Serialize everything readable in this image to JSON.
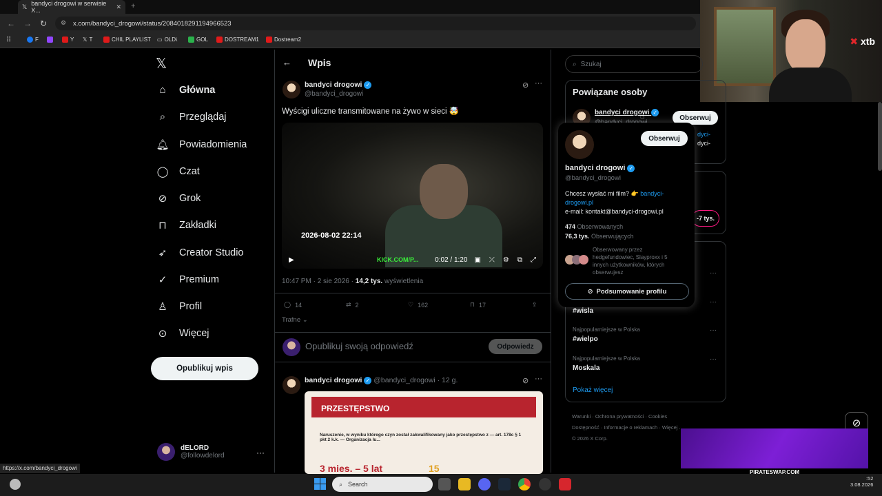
{
  "browser": {
    "tab_title": "bandyci drogowi w serwisie X...",
    "url": "x.com/bandyci_drogowi/status/2084018291194966523",
    "bookmarks": [
      "F",
      "Y",
      "T",
      "CHIL PLAYLIST",
      "OLD\\",
      "GOL",
      "DOSTREAM1",
      "Dostream2"
    ]
  },
  "webcam": {
    "brand": "xtb"
  },
  "nav": {
    "items": [
      "Główna",
      "Przeglądaj",
      "Powiadomienia",
      "Czat",
      "Grok",
      "Zakładki",
      "Creator Studio",
      "Premium",
      "Profil",
      "Więcej"
    ],
    "post_button": "Opublikuj wpis",
    "me_name": "dELORD",
    "me_handle": "@followdelord"
  },
  "post": {
    "header": "Wpis",
    "author": "bandyci drogowi",
    "handle": "@bandyci_drogowi",
    "text": "Wyścigi uliczne transmitowane na żywo w sieci 🤯",
    "video_stamp": "2026-08-02 22:14",
    "video_watermark": "KICK.COM/P...",
    "video_time": "0:02 / 1:20",
    "meta_time": "10:47 PM · 2 sie 2026 · ",
    "views_count": "14,2 tys.",
    "views_label": "wyświetlenia",
    "replies": "14",
    "reposts": "2",
    "likes": "162",
    "bookmarks": "17",
    "sort": "Trafne",
    "reply_placeholder": "Opublikuj swoją odpowiedź",
    "reply_button": "Odpowiedz"
  },
  "second_post": {
    "author": "bandyci drogowi",
    "handle": "@bandyci_drogowi · 12 g.",
    "card_title": "PRZESTĘPSTWO",
    "card_text": "Naruszenie, w wyniku którego czyn został zakwalifikowany jako przestępstwo z — art. 178c § 1 pkt 2 k.k. — Organizacja lu...",
    "card_sentence": "3 mies. – 5 lat",
    "card_points": "15"
  },
  "sidebar": {
    "search_placeholder": "Szukaj",
    "related_title": "Powiązane osoby",
    "related_name": "bandyci drogowi",
    "related_handle": "@bandyci_drogowi",
    "follow_label": "Obserwuj",
    "related_bio_fragment": "dyci-",
    "related_bio_fragment2": "dyci-",
    "pill_fragment": "-7 tys.",
    "trends": [
      {
        "label": "",
        "name": "#wisla"
      },
      {
        "label": "Najpopularniejsze w Polska",
        "name": "#wielpo"
      },
      {
        "label": "Najpopularniejsze w Polska",
        "name": "Moskala"
      }
    ],
    "show_more": "Pokaż więcej",
    "footer": [
      "Warunki",
      "Ochrona prywatności",
      "Cookies",
      "Dostępność",
      "Informacje o reklamach",
      "Więcej ...",
      "© 2026 X Corp."
    ]
  },
  "popup": {
    "name": "bandyci drogowi",
    "handle": "@bandyci_drogowi",
    "follow_label": "Obserwuj",
    "bio_prefix": "Chcesz wysłać mi film? 👉 ",
    "bio_link": "bandyci-drogowi.pl",
    "bio_email": "e-mail: kontakt@bandyci-drogowi.pl",
    "following_count": "474",
    "following_label": "Obserwowanych",
    "followers_count": "76,3 tys.",
    "followers_label": "Obserwujących",
    "followed_by": "Obserwowany przez hedgefundowiec, Slayproxx i 5 innych użytkowników, których obserwujesz",
    "summary_button": "Podsumowanie profilu"
  },
  "stream_overlay": {
    "banner": "PIRATESWAP.COM"
  },
  "status_link": "https://x.com/bandyci_drogowi",
  "taskbar": {
    "search": "Search",
    "time": ":52",
    "date": "3.08.2026"
  },
  "colors": {
    "accent": "#1d9bf0",
    "background": "#000000",
    "card_red": "#b8242e",
    "kick_green": "#3af03a"
  }
}
